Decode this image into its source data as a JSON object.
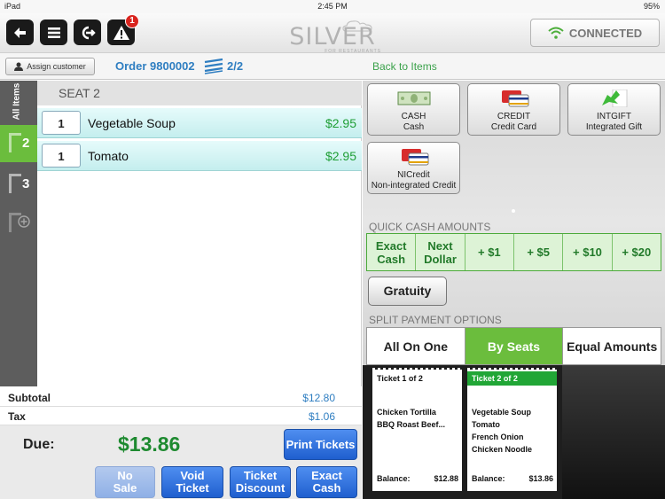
{
  "status_bar": {
    "device": "iPad",
    "time": "2:45 PM",
    "battery": "95%"
  },
  "top_bar": {
    "alert_count": "1",
    "logo": "SILVER",
    "logo_sub": "FOR RESTAURANTS",
    "connection": "CONNECTED"
  },
  "info_bar": {
    "assign_customer": "Assign customer",
    "order": "Order 9800002",
    "split": "2/2",
    "back": "Back to Items"
  },
  "side_nav": {
    "all_items": "All Items",
    "seats": [
      "2",
      "3"
    ]
  },
  "seat": {
    "header": "SEAT 2",
    "items": [
      {
        "qty": "1",
        "name": "Vegetable Soup",
        "price": "$2.95"
      },
      {
        "qty": "1",
        "name": "Tomato",
        "price": "$2.95"
      }
    ]
  },
  "totals": {
    "subtotal_label": "Subtotal",
    "subtotal": "$12.80",
    "tax_label": "Tax",
    "tax": "$1.06",
    "due_label": "Due:",
    "due": "$13.86"
  },
  "actions": {
    "print_tickets": "Print Tickets",
    "no_sale": [
      "No",
      "Sale"
    ],
    "void_ticket": [
      "Void",
      "Ticket"
    ],
    "ticket_discount": [
      "Ticket",
      "Discount"
    ],
    "exact_cash": [
      "Exact",
      "Cash"
    ]
  },
  "payment_methods": [
    {
      "code": "CASH",
      "name": "Cash",
      "icon": "cash-icon"
    },
    {
      "code": "CREDIT",
      "name": "Credit Card",
      "icon": "credit-card-icon"
    },
    {
      "code": "INTGIFT",
      "name": "Integrated Gift",
      "icon": "gift-card-icon"
    },
    {
      "code": "NICredit",
      "name": "Non-integrated Credit",
      "icon": "credit-card-icon"
    }
  ],
  "quick_cash": {
    "label": "QUICK CASH AMOUNTS",
    "options": [
      [
        "Exact",
        "Cash"
      ],
      [
        "Next",
        "Dollar"
      ],
      [
        "+ $1"
      ],
      [
        "+ $5"
      ],
      [
        "+ $10"
      ],
      [
        "+ $20"
      ]
    ]
  },
  "gratuity": "Gratuity",
  "split_payment": {
    "label": "SPLIT PAYMENT OPTIONS",
    "options": [
      "All On One",
      "By Seats",
      "Equal Amounts"
    ],
    "selected": "By Seats"
  },
  "tickets": [
    {
      "title": "Ticket 1 of 2",
      "lines": [
        "Chicken Tortilla",
        "BBQ Roast Beef..."
      ],
      "balance_label": "Balance:",
      "balance": "$12.88"
    },
    {
      "title": "Ticket 2 of 2",
      "lines": [
        "Vegetable Soup",
        "Tomato",
        "French Onion",
        "Chicken Noodle"
      ],
      "balance_label": "Balance:",
      "balance": "$13.86"
    }
  ],
  "colors": {
    "accent_green": "#6bbd3d",
    "price_green": "#1e9e35",
    "link_blue": "#2f7ec1",
    "button_blue": "#1f5fcf"
  }
}
